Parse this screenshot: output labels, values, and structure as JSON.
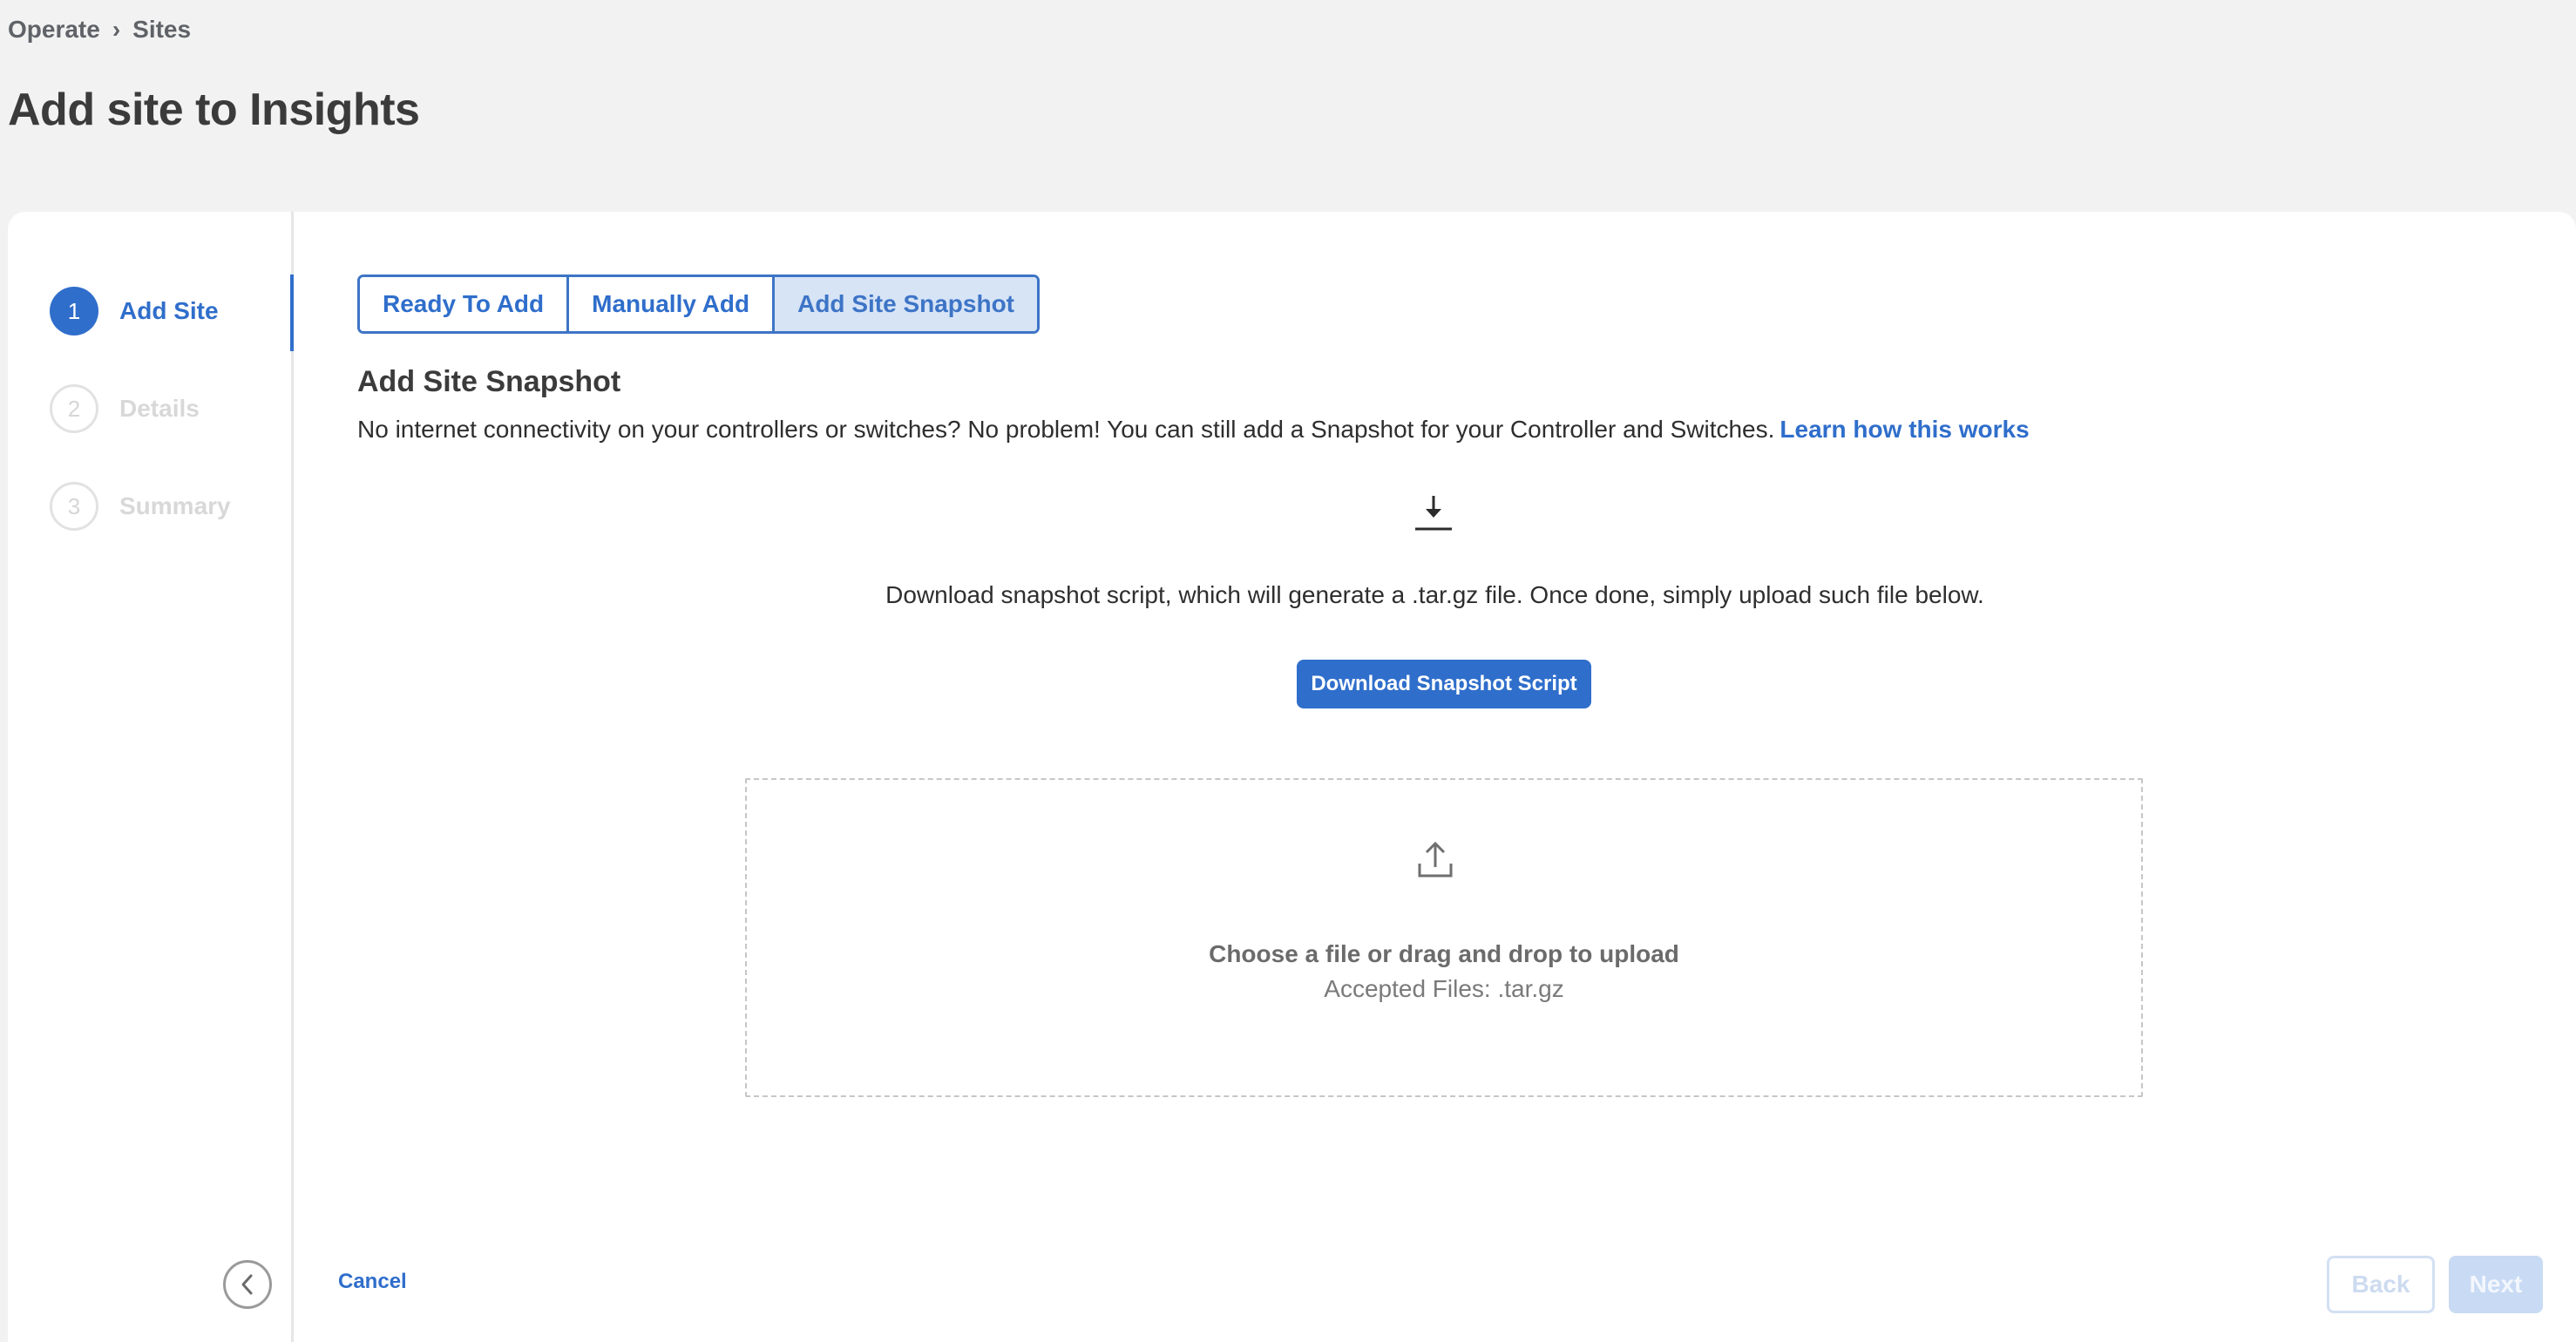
{
  "breadcrumb": {
    "items": [
      "Operate",
      "Sites"
    ],
    "separator": "›"
  },
  "page": {
    "title": "Add site to Insights"
  },
  "stepper": {
    "steps": [
      {
        "number": "1",
        "label": "Add Site",
        "state": "active"
      },
      {
        "number": "2",
        "label": "Details",
        "state": "inactive"
      },
      {
        "number": "3",
        "label": "Summary",
        "state": "inactive"
      }
    ],
    "collapse_icon": "chevron-left-icon"
  },
  "tabs": {
    "items": [
      "Ready To Add",
      "Manually Add",
      "Add Site Snapshot"
    ],
    "selected": "Add Site Snapshot"
  },
  "section": {
    "title": "Add Site Snapshot",
    "intro": "No internet connectivity on your controllers or switches? No problem! You can still add a Snapshot for your Controller and Switches.",
    "learn_link": "Learn how this works"
  },
  "download": {
    "icon": "download-icon",
    "instructions": "Download snapshot script, which will generate a .tar.gz file. Once done, simply upload such file below.",
    "button_label": "Download Snapshot Script"
  },
  "dropzone": {
    "icon": "upload-icon",
    "title": "Choose a file or drag and drop to upload",
    "accepted": "Accepted Files: .tar.gz"
  },
  "footer": {
    "cancel_label": "Cancel",
    "back_label": "Back",
    "next_label": "Next"
  },
  "colors": {
    "accent": "#2f6ecb",
    "page_bg": "#f2f2f2",
    "disabled": "#c9dbf4"
  }
}
